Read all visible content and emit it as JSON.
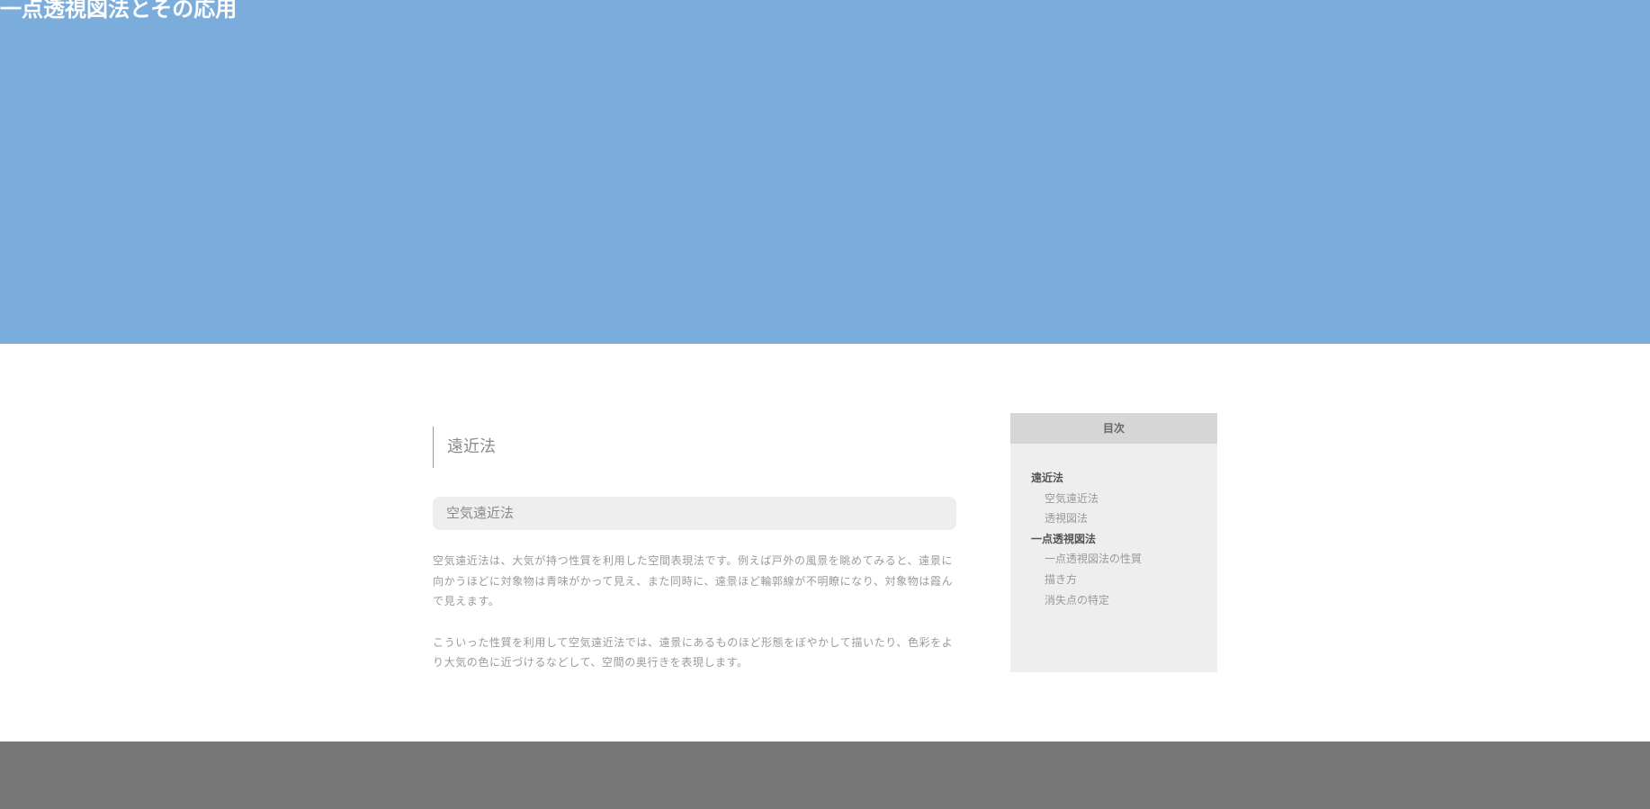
{
  "header": {
    "title": "一点透視図法とその応用"
  },
  "article": {
    "section_title": "遠近法",
    "subsection_title": "空気遠近法",
    "paragraphs": [
      "空気遠近法は、大気が持つ性質を利用した空間表現法です。例えば戸外の風景を眺めてみると、遠景に向かうほどに対象物は青味がかって見え、また同時に、遠景ほど輪郭線が不明瞭になり、対象物は霞んで見えます。",
      "こういった性質を利用して空気遠近法では、遠景にあるものほど形態をぼやかして描いたり、色彩をより大気の色に近づけるなどして、空間の奥行きを表現します。"
    ]
  },
  "toc": {
    "title": "目次",
    "items": [
      {
        "label": "遠近法",
        "level": 1
      },
      {
        "label": "空気遠近法",
        "level": 2
      },
      {
        "label": "透視図法",
        "level": 2
      },
      {
        "label": "一点透視図法",
        "level": 1
      },
      {
        "label": "一点透視図法の性質",
        "level": 2
      },
      {
        "label": "描き方",
        "level": 2
      },
      {
        "label": "消失点の特定",
        "level": 2
      }
    ]
  },
  "colors": {
    "hero_background": "#7aaddc",
    "footer_background": "#787878",
    "toc_background": "#eeeeee",
    "toc_header_background": "#d6d6d6"
  }
}
